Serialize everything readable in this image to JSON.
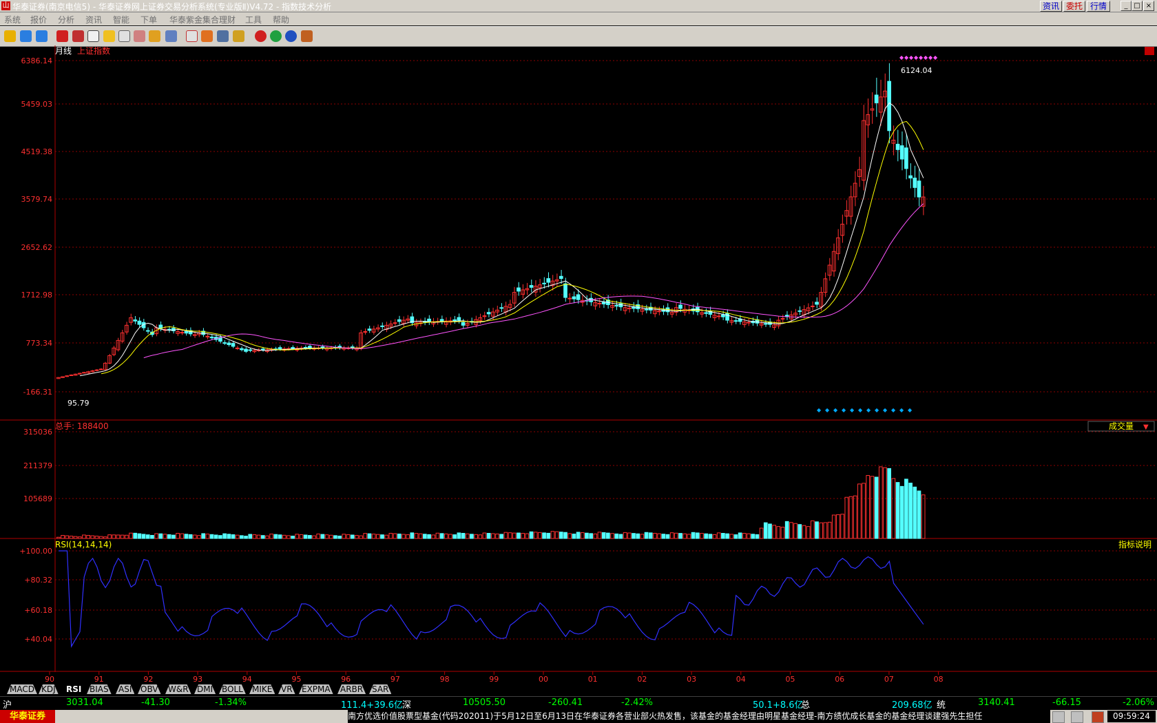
{
  "window": {
    "title": "华泰证券(南京电信5) - 华泰证券网上证券交易分析系统(专业版Ⅱ)V4.72 - 指数技术分析",
    "buttons": [
      "资讯",
      "委托",
      "行情"
    ],
    "controls": [
      "_",
      "□",
      "×"
    ]
  },
  "menu": [
    "系统",
    "报价",
    "分析",
    "资讯",
    "智能",
    "下单",
    "华泰紫金集合理财",
    "工具",
    "帮助"
  ],
  "toolbar_icons": [
    "back-arrow-icon",
    "up-arrow-icon",
    "down-arrow-icon",
    "kline-icon",
    "chart-icon",
    "window-icon",
    "pencil-icon",
    "f10-icon",
    "formula-icon",
    "check-icon",
    "book-icon",
    "memo-icon",
    "calc-icon",
    "grid-icon",
    "portfolio-icon",
    "stop-icon",
    "green-icon",
    "bank-icon",
    "tools-icon"
  ],
  "main_chart": {
    "period": "月线",
    "index_name": "上证指数",
    "y_ticks": [
      "6386.14",
      "5459.03",
      "4519.38",
      "3579.74",
      "2652.62",
      "1712.98",
      "773.34",
      "-166.31"
    ],
    "ylim": [
      -166.31,
      6386.14
    ],
    "high_label": "6124.04",
    "low_label": "95.79",
    "colors": {
      "up": "#ff3030",
      "down": "#54ffff",
      "ma1": "#ffffff",
      "ma2": "#ffff00",
      "ma3": "#ff55ff"
    }
  },
  "volume_chart": {
    "label": "总手: 188400",
    "y_ticks": [
      "315036",
      "211379",
      "105689"
    ],
    "selector": "成交量"
  },
  "rsi_chart": {
    "label": "RSI(14,14,14)",
    "y_ticks": [
      "+100.00",
      "+80.32",
      "+60.18",
      "+40.04"
    ],
    "help": "指标说明"
  },
  "x_axis": [
    "90",
    "91",
    "92",
    "93",
    "94",
    "95",
    "96",
    "97",
    "98",
    "99",
    "00",
    "01",
    "02",
    "03",
    "04",
    "05",
    "06",
    "07",
    "08"
  ],
  "indicator_tabs": [
    "MACD",
    "KDJ",
    "RSI",
    "BIAS",
    "ASI",
    "OBV",
    "W&R",
    "DMI",
    "BOLL",
    "MIKE",
    "VR",
    "EXPMA",
    "ARBR",
    "SAR"
  ],
  "active_tab": "RSI",
  "quotes": {
    "sh_label": "沪",
    "sh_price": "3031.04",
    "sh_change": "-41.30",
    "sh_pct": "-1.34%",
    "sh_amount": "111.4+39.6亿",
    "sz_label": "深",
    "sz_price": "10505.50",
    "sz_change": "-260.41",
    "sz_pct": "-2.42%",
    "sz_amount": "50.1+8.6亿",
    "tot_label": "总",
    "tot_amount": "209.68亿",
    "tong_label": "统",
    "tong_price": "3140.41",
    "tong_change": "-66.15",
    "tong_pct": "-2.06%"
  },
  "status": {
    "brand": "华泰证券",
    "marquee": "南方优选价值股票型基金(代码202011)于5月12日至6月13日在华泰证券各营业部火热发售，该基金的基金经理由明星基金经理-南方绩优成长基金的基金经理谈建强先生担任",
    "clock": "09:59:24"
  }
}
